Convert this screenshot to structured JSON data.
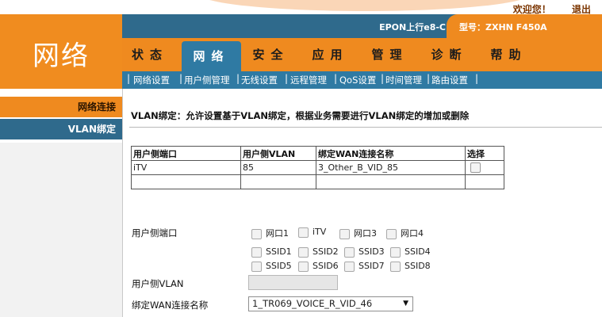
{
  "header": {
    "top_links": [
      "欢迎您！",
      "退出"
    ],
    "brand_title": "网络",
    "device": "EPON上行e8-C",
    "model": "型号：ZXHN F450A"
  },
  "main_nav": [
    "状态",
    "网络",
    "安全",
    "应用",
    "管理",
    "诊断",
    "帮助"
  ],
  "active_tab": "网络",
  "sub_nav": [
    "网络设置",
    "用户侧管理",
    "无线设置",
    "远程管理",
    "QoS设置",
    "时间管理",
    "路由设置"
  ],
  "sidebar": [
    {
      "label": "网络连接"
    },
    {
      "label": "VLAN绑定"
    }
  ],
  "content": {
    "description": "VLAN绑定：允许设置基于VLAN绑定，根据业务需要进行VLAN绑定的增加或删除",
    "table": {
      "headers": [
        "用户侧端口",
        "用户侧VLAN",
        "绑定WAN连接名称",
        "选择"
      ],
      "rows": [
        {
          "port": "iTV",
          "vlan": "85",
          "wan": "3_Other_B_VID_85"
        }
      ]
    },
    "form": {
      "port_label": "用户侧端口",
      "ports_row1": [
        "网口1",
        "iTV",
        "网口3",
        "网口4"
      ],
      "ports_row2": [
        "SSID1",
        "SSID2",
        "SSID3",
        "SSID4"
      ],
      "ports_row3": [
        "SSID5",
        "SSID6",
        "SSID7",
        "SSID8"
      ],
      "vlan_label": "用户侧VLAN",
      "vlan_value": "",
      "wan_label": "绑定WAN连接名称",
      "wan_selected": "1_TR069_VOICE_R_VID_46"
    }
  },
  "colors": {
    "orange": "#ef8a1f",
    "blue": "#2f7aa3",
    "dark_blue": "#2f6a8c"
  }
}
